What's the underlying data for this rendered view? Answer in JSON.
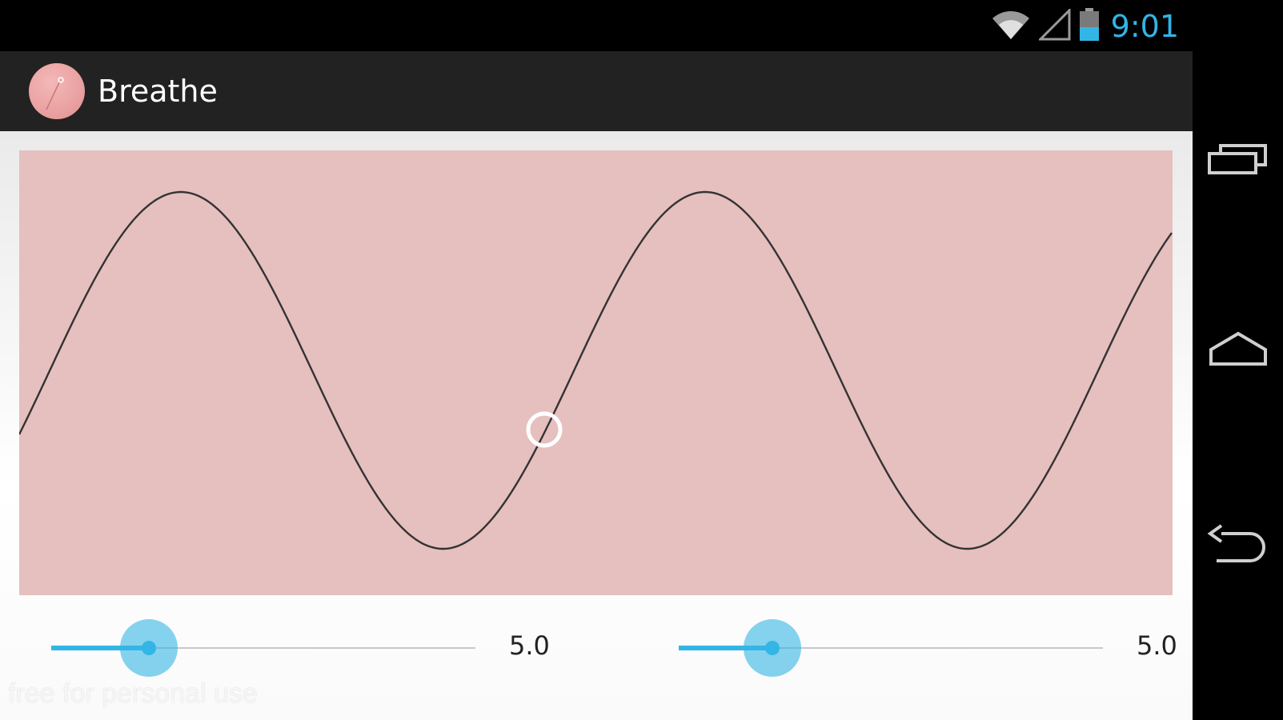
{
  "status_bar": {
    "time": "9:01",
    "icons": [
      "wifi-icon",
      "signal-icon",
      "battery-icon"
    ],
    "accent_color": "#33b5e5"
  },
  "action_bar": {
    "app_name": "Breathe",
    "app_icon": "breathe-app-icon"
  },
  "wave": {
    "background_color": "#e6bfbf",
    "line_color": "#333333",
    "marker": "breath-position-marker"
  },
  "sliders": [
    {
      "value_label": "5.0",
      "fraction": 0.23
    },
    {
      "value_label": "5.0",
      "fraction": 0.22
    }
  ],
  "watermark": "free for personal use",
  "nav_bar": {
    "buttons": [
      "recent-apps-icon",
      "home-icon",
      "back-icon"
    ]
  }
}
